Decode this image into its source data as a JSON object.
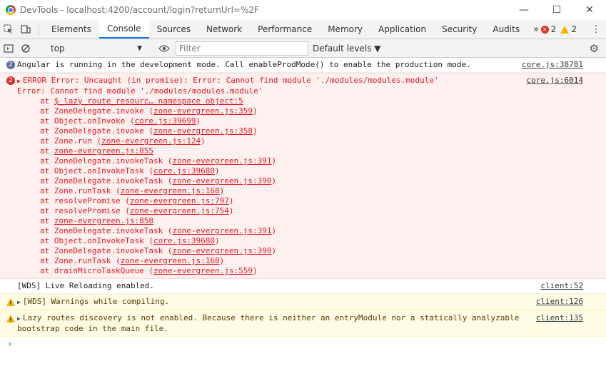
{
  "window": {
    "title": "DevTools - localhost:4200/account/login?returnUrl=%2F",
    "minimize": "—",
    "maximize": "☐",
    "close": "✕"
  },
  "tabs": [
    {
      "label": "Elements"
    },
    {
      "label": "Console",
      "active": true
    },
    {
      "label": "Sources"
    },
    {
      "label": "Network"
    },
    {
      "label": "Performance"
    },
    {
      "label": "Memory"
    },
    {
      "label": "Application"
    },
    {
      "label": "Security"
    },
    {
      "label": "Audits"
    }
  ],
  "tab_overflow": "»",
  "counts": {
    "errors": "2",
    "warnings": "2"
  },
  "toolbar": {
    "context": "top",
    "filter_placeholder": "Filter",
    "levels": "Default levels ▼"
  },
  "icons": {
    "inspect": "inspect-icon",
    "device": "device-icon",
    "sidebar": "sidebar-toggle-icon",
    "clear": "clear-console-icon",
    "eye": "eye-icon",
    "gear": "gear-icon"
  },
  "colors": {
    "error": "#e01b24",
    "error_bg": "#fff0f0",
    "warning_bg": "#fffbe5",
    "accent": "#1a73e8"
  },
  "messages": {
    "info": {
      "count": "2",
      "text": "Angular is running in the development mode. Call enableProdMode() to enable the production mode.",
      "source": "core.js:38781"
    },
    "error": {
      "count": "2",
      "header": "ERROR Error: Uncaught (in promise): Error: Cannot find module './modules/modules.module'",
      "source": "core.js:6014",
      "message": "Error: Cannot find module './modules/modules.module'",
      "stack": [
        {
          "fn": "at ",
          "loc": "$_lazy_route_resourc… namespace object:5",
          "tail": ""
        },
        {
          "fn": "at ZoneDelegate.invoke (",
          "loc": "zone-evergreen.js:359",
          "tail": ")"
        },
        {
          "fn": "at Object.onInvoke (",
          "loc": "core.js:39699",
          "tail": ")"
        },
        {
          "fn": "at ZoneDelegate.invoke (",
          "loc": "zone-evergreen.js:358",
          "tail": ")"
        },
        {
          "fn": "at Zone.run (",
          "loc": "zone-evergreen.js:124",
          "tail": ")"
        },
        {
          "fn": "at ",
          "loc": "zone-evergreen.js:855",
          "tail": ""
        },
        {
          "fn": "at ZoneDelegate.invokeTask (",
          "loc": "zone-evergreen.js:391",
          "tail": ")"
        },
        {
          "fn": "at Object.onInvokeTask (",
          "loc": "core.js:39680",
          "tail": ")"
        },
        {
          "fn": "at ZoneDelegate.invokeTask (",
          "loc": "zone-evergreen.js:390",
          "tail": ")"
        },
        {
          "fn": "at Zone.runTask (",
          "loc": "zone-evergreen.js:168",
          "tail": ")"
        },
        {
          "fn": "at resolvePromise (",
          "loc": "zone-evergreen.js:797",
          "tail": ")"
        },
        {
          "fn": "at resolvePromise (",
          "loc": "zone-evergreen.js:754",
          "tail": ")"
        },
        {
          "fn": "at ",
          "loc": "zone-evergreen.js:858",
          "tail": ""
        },
        {
          "fn": "at ZoneDelegate.invokeTask (",
          "loc": "zone-evergreen.js:391",
          "tail": ")"
        },
        {
          "fn": "at Object.onInvokeTask (",
          "loc": "core.js:39680",
          "tail": ")"
        },
        {
          "fn": "at ZoneDelegate.invokeTask (",
          "loc": "zone-evergreen.js:390",
          "tail": ")"
        },
        {
          "fn": "at Zone.runTask (",
          "loc": "zone-evergreen.js:168",
          "tail": ")"
        },
        {
          "fn": "at drainMicroTaskQueue (",
          "loc": "zone-evergreen.js:559",
          "tail": ")"
        }
      ]
    },
    "wds": {
      "text": "[WDS] Live Reloading enabled.",
      "source": "client:52"
    },
    "warn1": {
      "text": "[WDS] Warnings while compiling.",
      "source": "client:126"
    },
    "warn2": {
      "text": "Lazy routes discovery is not enabled. Because there is neither an entryModule nor a statically analyzable bootstrap code in the main file.",
      "source": "client:135"
    }
  },
  "prompt": "›"
}
